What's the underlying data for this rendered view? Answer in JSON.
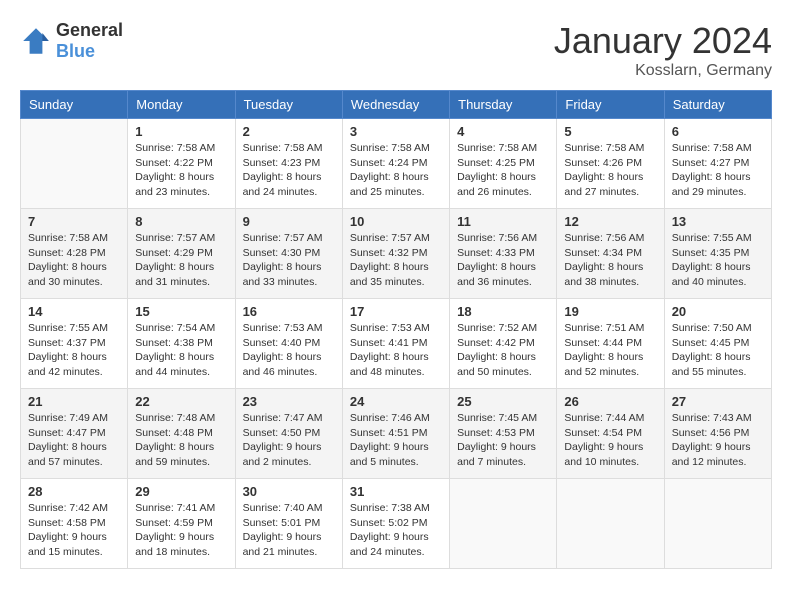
{
  "logo": {
    "general": "General",
    "blue": "Blue"
  },
  "title": {
    "month_year": "January 2024",
    "location": "Kosslarn, Germany"
  },
  "headers": [
    "Sunday",
    "Monday",
    "Tuesday",
    "Wednesday",
    "Thursday",
    "Friday",
    "Saturday"
  ],
  "weeks": [
    [
      {
        "day": "",
        "info": ""
      },
      {
        "day": "1",
        "info": "Sunrise: 7:58 AM\nSunset: 4:22 PM\nDaylight: 8 hours\nand 23 minutes."
      },
      {
        "day": "2",
        "info": "Sunrise: 7:58 AM\nSunset: 4:23 PM\nDaylight: 8 hours\nand 24 minutes."
      },
      {
        "day": "3",
        "info": "Sunrise: 7:58 AM\nSunset: 4:24 PM\nDaylight: 8 hours\nand 25 minutes."
      },
      {
        "day": "4",
        "info": "Sunrise: 7:58 AM\nSunset: 4:25 PM\nDaylight: 8 hours\nand 26 minutes."
      },
      {
        "day": "5",
        "info": "Sunrise: 7:58 AM\nSunset: 4:26 PM\nDaylight: 8 hours\nand 27 minutes."
      },
      {
        "day": "6",
        "info": "Sunrise: 7:58 AM\nSunset: 4:27 PM\nDaylight: 8 hours\nand 29 minutes."
      }
    ],
    [
      {
        "day": "7",
        "info": "Sunrise: 7:58 AM\nSunset: 4:28 PM\nDaylight: 8 hours\nand 30 minutes."
      },
      {
        "day": "8",
        "info": "Sunrise: 7:57 AM\nSunset: 4:29 PM\nDaylight: 8 hours\nand 31 minutes."
      },
      {
        "day": "9",
        "info": "Sunrise: 7:57 AM\nSunset: 4:30 PM\nDaylight: 8 hours\nand 33 minutes."
      },
      {
        "day": "10",
        "info": "Sunrise: 7:57 AM\nSunset: 4:32 PM\nDaylight: 8 hours\nand 35 minutes."
      },
      {
        "day": "11",
        "info": "Sunrise: 7:56 AM\nSunset: 4:33 PM\nDaylight: 8 hours\nand 36 minutes."
      },
      {
        "day": "12",
        "info": "Sunrise: 7:56 AM\nSunset: 4:34 PM\nDaylight: 8 hours\nand 38 minutes."
      },
      {
        "day": "13",
        "info": "Sunrise: 7:55 AM\nSunset: 4:35 PM\nDaylight: 8 hours\nand 40 minutes."
      }
    ],
    [
      {
        "day": "14",
        "info": "Sunrise: 7:55 AM\nSunset: 4:37 PM\nDaylight: 8 hours\nand 42 minutes."
      },
      {
        "day": "15",
        "info": "Sunrise: 7:54 AM\nSunset: 4:38 PM\nDaylight: 8 hours\nand 44 minutes."
      },
      {
        "day": "16",
        "info": "Sunrise: 7:53 AM\nSunset: 4:40 PM\nDaylight: 8 hours\nand 46 minutes."
      },
      {
        "day": "17",
        "info": "Sunrise: 7:53 AM\nSunset: 4:41 PM\nDaylight: 8 hours\nand 48 minutes."
      },
      {
        "day": "18",
        "info": "Sunrise: 7:52 AM\nSunset: 4:42 PM\nDaylight: 8 hours\nand 50 minutes."
      },
      {
        "day": "19",
        "info": "Sunrise: 7:51 AM\nSunset: 4:44 PM\nDaylight: 8 hours\nand 52 minutes."
      },
      {
        "day": "20",
        "info": "Sunrise: 7:50 AM\nSunset: 4:45 PM\nDaylight: 8 hours\nand 55 minutes."
      }
    ],
    [
      {
        "day": "21",
        "info": "Sunrise: 7:49 AM\nSunset: 4:47 PM\nDaylight: 8 hours\nand 57 minutes."
      },
      {
        "day": "22",
        "info": "Sunrise: 7:48 AM\nSunset: 4:48 PM\nDaylight: 8 hours\nand 59 minutes."
      },
      {
        "day": "23",
        "info": "Sunrise: 7:47 AM\nSunset: 4:50 PM\nDaylight: 9 hours\nand 2 minutes."
      },
      {
        "day": "24",
        "info": "Sunrise: 7:46 AM\nSunset: 4:51 PM\nDaylight: 9 hours\nand 5 minutes."
      },
      {
        "day": "25",
        "info": "Sunrise: 7:45 AM\nSunset: 4:53 PM\nDaylight: 9 hours\nand 7 minutes."
      },
      {
        "day": "26",
        "info": "Sunrise: 7:44 AM\nSunset: 4:54 PM\nDaylight: 9 hours\nand 10 minutes."
      },
      {
        "day": "27",
        "info": "Sunrise: 7:43 AM\nSunset: 4:56 PM\nDaylight: 9 hours\nand 12 minutes."
      }
    ],
    [
      {
        "day": "28",
        "info": "Sunrise: 7:42 AM\nSunset: 4:58 PM\nDaylight: 9 hours\nand 15 minutes."
      },
      {
        "day": "29",
        "info": "Sunrise: 7:41 AM\nSunset: 4:59 PM\nDaylight: 9 hours\nand 18 minutes."
      },
      {
        "day": "30",
        "info": "Sunrise: 7:40 AM\nSunset: 5:01 PM\nDaylight: 9 hours\nand 21 minutes."
      },
      {
        "day": "31",
        "info": "Sunrise: 7:38 AM\nSunset: 5:02 PM\nDaylight: 9 hours\nand 24 minutes."
      },
      {
        "day": "",
        "info": ""
      },
      {
        "day": "",
        "info": ""
      },
      {
        "day": "",
        "info": ""
      }
    ]
  ]
}
